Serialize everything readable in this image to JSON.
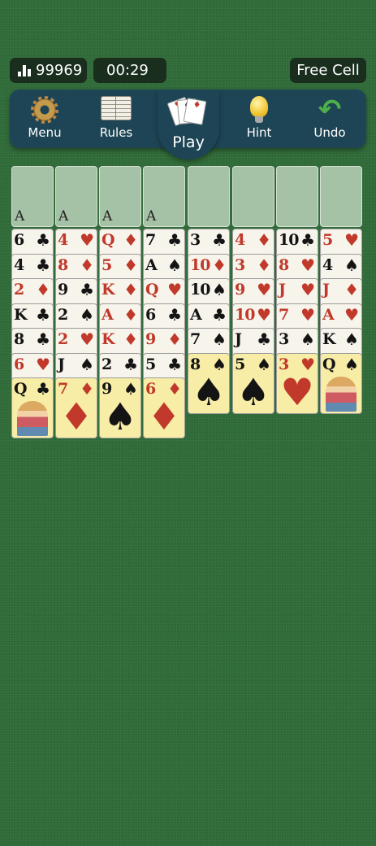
{
  "header": {
    "score": "99969",
    "score_icon": "leaderboard-bars-icon",
    "timer": "00:29",
    "timer_icon": "clock-icon",
    "game_name": "Free Cell"
  },
  "toolbar": {
    "menu_label": "Menu",
    "rules_label": "Rules",
    "play_label": "Play",
    "hint_label": "Hint",
    "undo_label": "Undo",
    "icons": [
      "gear-icon",
      "book-icon",
      "cards-icon",
      "lightbulb-icon",
      "undo-arrow-icon"
    ]
  },
  "slots": [
    {
      "label": "A"
    },
    {
      "label": "A"
    },
    {
      "label": "A"
    },
    {
      "label": "A"
    },
    {
      "label": ""
    },
    {
      "label": ""
    },
    {
      "label": ""
    },
    {
      "label": ""
    }
  ],
  "colors": {
    "felt": "#2f6b38",
    "toolbar": "#1e4555",
    "highlight_card": "#f8eda6",
    "red_suit": "#c0392b"
  },
  "columns": [
    [
      {
        "rank": "6",
        "suit": "♣",
        "color": "black"
      },
      {
        "rank": "4",
        "suit": "♣",
        "color": "black"
      },
      {
        "rank": "2",
        "suit": "♦",
        "color": "red"
      },
      {
        "rank": "K",
        "suit": "♣",
        "color": "black"
      },
      {
        "rank": "8",
        "suit": "♣",
        "color": "black"
      },
      {
        "rank": "6",
        "suit": "♥",
        "color": "red"
      },
      {
        "rank": "Q",
        "suit": "♣",
        "color": "black",
        "highlight": true,
        "face": true
      }
    ],
    [
      {
        "rank": "4",
        "suit": "♥",
        "color": "red"
      },
      {
        "rank": "8",
        "suit": "♦",
        "color": "red"
      },
      {
        "rank": "9",
        "suit": "♣",
        "color": "black"
      },
      {
        "rank": "2",
        "suit": "♠",
        "color": "black"
      },
      {
        "rank": "2",
        "suit": "♥",
        "color": "red"
      },
      {
        "rank": "J",
        "suit": "♠",
        "color": "black"
      },
      {
        "rank": "7",
        "suit": "♦",
        "color": "red",
        "highlight": true
      }
    ],
    [
      {
        "rank": "Q",
        "suit": "♦",
        "color": "red"
      },
      {
        "rank": "5",
        "suit": "♦",
        "color": "red"
      },
      {
        "rank": "K",
        "suit": "♦",
        "color": "red"
      },
      {
        "rank": "A",
        "suit": "♦",
        "color": "red"
      },
      {
        "rank": "K",
        "suit": "♦",
        "color": "red"
      },
      {
        "rank": "2",
        "suit": "♣",
        "color": "black"
      },
      {
        "rank": "9",
        "suit": "♠",
        "color": "black",
        "highlight": true
      }
    ],
    [
      {
        "rank": "7",
        "suit": "♣",
        "color": "black"
      },
      {
        "rank": "A",
        "suit": "♠",
        "color": "black"
      },
      {
        "rank": "Q",
        "suit": "♥",
        "color": "red"
      },
      {
        "rank": "6",
        "suit": "♣",
        "color": "black"
      },
      {
        "rank": "9",
        "suit": "♦",
        "color": "red"
      },
      {
        "rank": "5",
        "suit": "♣",
        "color": "black"
      },
      {
        "rank": "6",
        "suit": "♦",
        "color": "red",
        "highlight": true
      }
    ],
    [
      {
        "rank": "3",
        "suit": "♣",
        "color": "black"
      },
      {
        "rank": "10",
        "suit": "♦",
        "color": "red"
      },
      {
        "rank": "10",
        "suit": "♠",
        "color": "black"
      },
      {
        "rank": "A",
        "suit": "♣",
        "color": "black"
      },
      {
        "rank": "7",
        "suit": "♠",
        "color": "black"
      },
      {
        "rank": "8",
        "suit": "♠",
        "color": "black",
        "highlight": true
      }
    ],
    [
      {
        "rank": "4",
        "suit": "♦",
        "color": "red"
      },
      {
        "rank": "3",
        "suit": "♦",
        "color": "red"
      },
      {
        "rank": "9",
        "suit": "♥",
        "color": "red"
      },
      {
        "rank": "10",
        "suit": "♥",
        "color": "red"
      },
      {
        "rank": "J",
        "suit": "♣",
        "color": "black"
      },
      {
        "rank": "5",
        "suit": "♠",
        "color": "black",
        "highlight": true
      }
    ],
    [
      {
        "rank": "10",
        "suit": "♣",
        "color": "black"
      },
      {
        "rank": "8",
        "suit": "♥",
        "color": "red"
      },
      {
        "rank": "J",
        "suit": "♥",
        "color": "red"
      },
      {
        "rank": "7",
        "suit": "♥",
        "color": "red"
      },
      {
        "rank": "3",
        "suit": "♠",
        "color": "black"
      },
      {
        "rank": "3",
        "suit": "♥",
        "color": "red",
        "highlight": true
      }
    ],
    [
      {
        "rank": "5",
        "suit": "♥",
        "color": "red"
      },
      {
        "rank": "4",
        "suit": "♠",
        "color": "black"
      },
      {
        "rank": "J",
        "suit": "♦",
        "color": "red"
      },
      {
        "rank": "A",
        "suit": "♥",
        "color": "red"
      },
      {
        "rank": "K",
        "suit": "♠",
        "color": "black"
      },
      {
        "rank": "Q",
        "suit": "♠",
        "color": "black",
        "highlight": true,
        "face": true
      }
    ]
  ]
}
